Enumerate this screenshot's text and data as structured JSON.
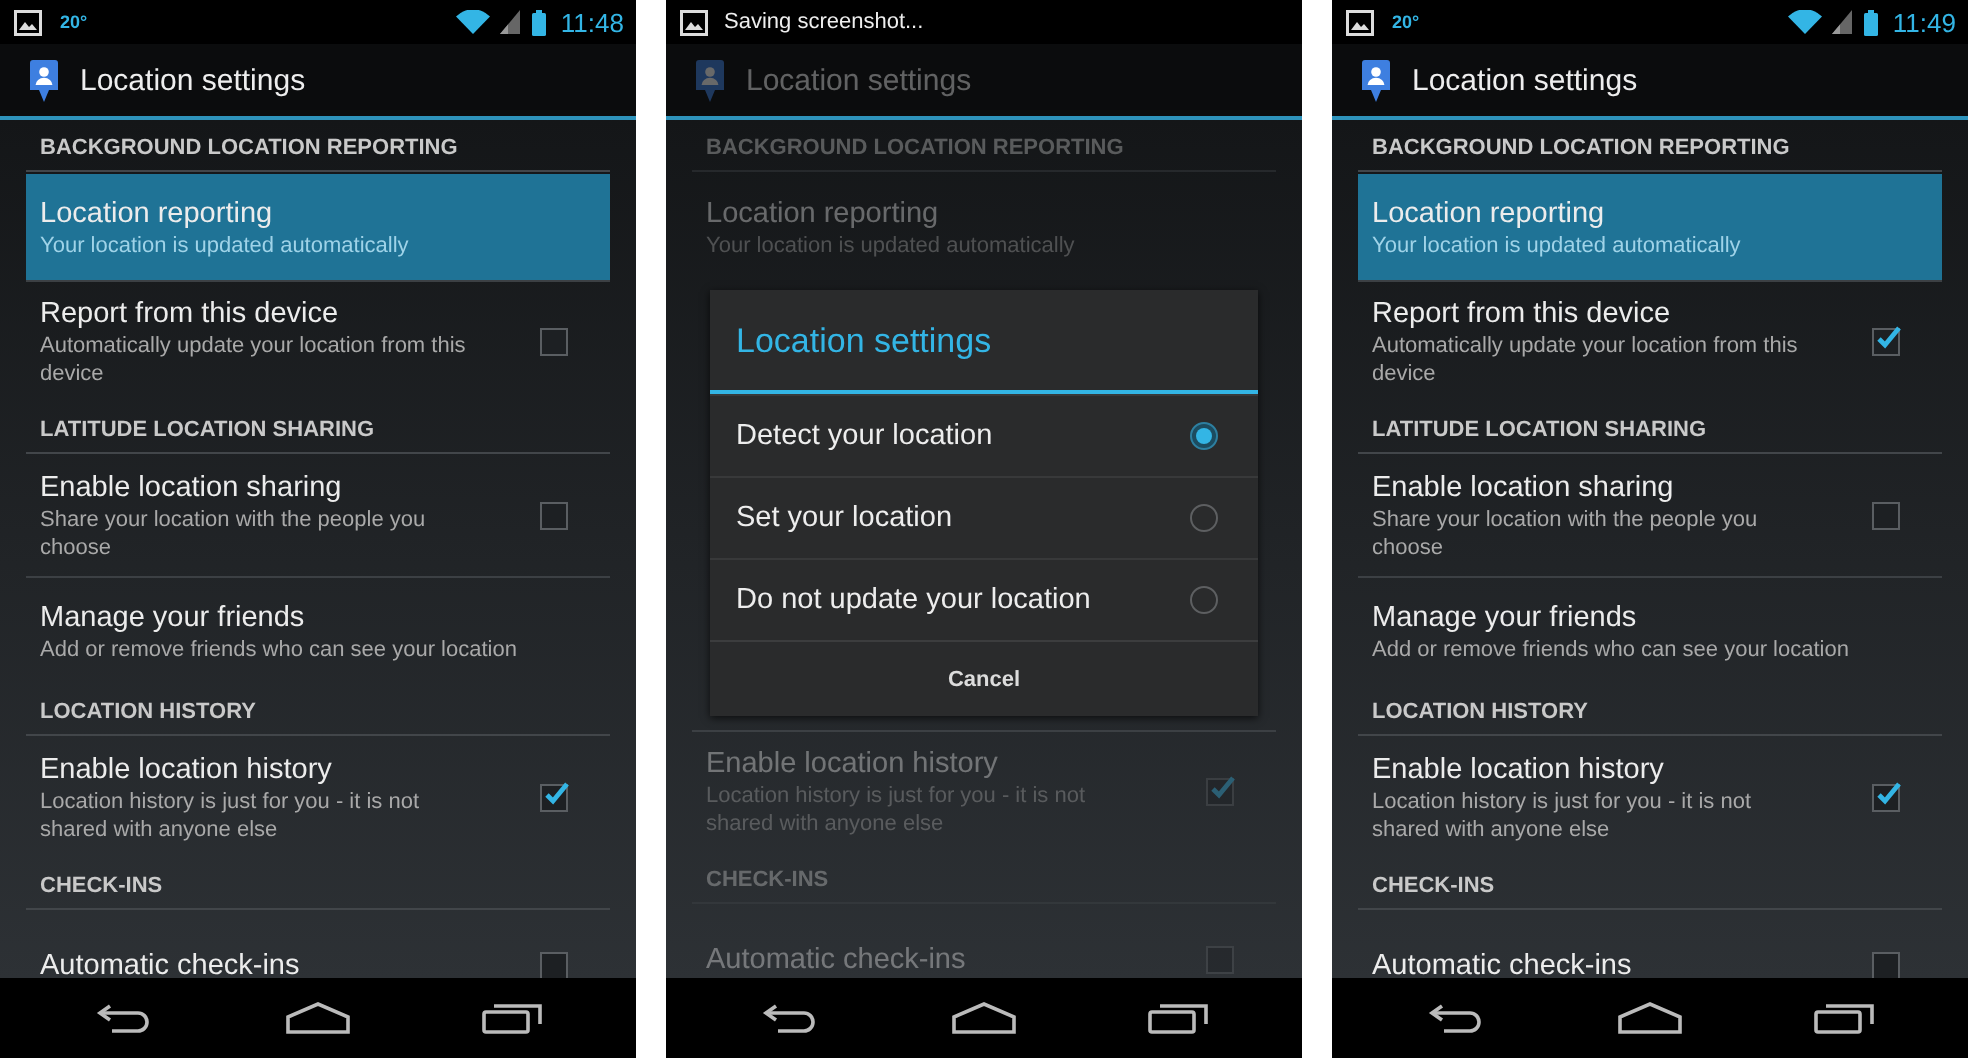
{
  "phones": [
    {
      "status_bar": {
        "notification": {
          "kind": "temperature",
          "text": "20°"
        },
        "time": "11:48"
      },
      "action_bar": {
        "title": "Location settings"
      },
      "dimmed": false,
      "content": [
        {
          "kind": "section",
          "header": "BACKGROUND LOCATION REPORTING",
          "items": [
            {
              "kind": "link",
              "title": "Location reporting",
              "subtitle": "Your location is updated automatically",
              "highlighted": true
            },
            {
              "kind": "checkbox",
              "title": "Report from this device",
              "subtitle": "Automatically update your location from this device",
              "checked": false,
              "highlighted": false
            }
          ]
        },
        {
          "kind": "section",
          "header": "LATITUDE LOCATION SHARING",
          "items": [
            {
              "kind": "checkbox",
              "title": "Enable location sharing",
              "subtitle": "Share your location with the people you choose",
              "checked": false,
              "highlighted": false
            },
            {
              "kind": "link",
              "title": "Manage your friends",
              "subtitle": "Add or remove friends who can see your location",
              "highlighted": false
            }
          ]
        },
        {
          "kind": "section",
          "header": "LOCATION HISTORY",
          "items": [
            {
              "kind": "checkbox",
              "title": "Enable location history",
              "subtitle": "Location history is just for you - it is not shared with anyone else",
              "checked": true,
              "highlighted": false
            }
          ]
        },
        {
          "kind": "section",
          "header": "CHECK-INS",
          "items": [
            {
              "kind": "checkbox",
              "title": "Automatic check-ins",
              "checked": false,
              "highlighted": false
            }
          ]
        }
      ]
    },
    {
      "status_bar": {
        "notification": {
          "kind": "message",
          "text": "Saving screenshot..."
        }
      },
      "action_bar": {
        "title": "Location settings"
      },
      "dimmed": true,
      "content": [
        {
          "kind": "section",
          "header": "BACKGROUND LOCATION REPORTING",
          "items": [
            {
              "kind": "link",
              "title": "Location reporting",
              "subtitle": "Your location is updated automatically",
              "highlighted": false
            }
          ]
        },
        {
          "kind": "dialog",
          "title": "Location settings",
          "options": [
            {
              "label": "Detect your location",
              "selected": true
            },
            {
              "label": "Set your location",
              "selected": false
            },
            {
              "label": "Do not update your location",
              "selected": false
            }
          ],
          "button": "Cancel"
        },
        {
          "kind": "section",
          "items": [
            {
              "kind": "checkbox",
              "title": "Enable location history",
              "subtitle": "Location history is just for you - it is not shared with anyone else",
              "checked": true,
              "highlighted": false
            }
          ]
        },
        {
          "kind": "section",
          "header": "CHECK-INS",
          "items": [
            {
              "kind": "checkbox",
              "title": "Automatic check-ins",
              "checked": false,
              "highlighted": false
            }
          ]
        }
      ]
    },
    {
      "status_bar": {
        "notification": {
          "kind": "temperature",
          "text": "20°"
        },
        "time": "11:49"
      },
      "action_bar": {
        "title": "Location settings"
      },
      "dimmed": false,
      "content": [
        {
          "kind": "section",
          "header": "BACKGROUND LOCATION REPORTING",
          "items": [
            {
              "kind": "link",
              "title": "Location reporting",
              "subtitle": "Your location is updated automatically",
              "highlighted": true
            },
            {
              "kind": "checkbox",
              "title": "Report from this device",
              "subtitle": "Automatically update your location from this device",
              "checked": true,
              "highlighted": false
            }
          ]
        },
        {
          "kind": "section",
          "header": "LATITUDE LOCATION SHARING",
          "items": [
            {
              "kind": "checkbox",
              "title": "Enable location sharing",
              "subtitle": "Share your location with the people you choose",
              "checked": false,
              "highlighted": false
            },
            {
              "kind": "link",
              "title": "Manage your friends",
              "subtitle": "Add or remove friends who can see your location",
              "highlighted": false
            }
          ]
        },
        {
          "kind": "section",
          "header": "LOCATION HISTORY",
          "items": [
            {
              "kind": "checkbox",
              "title": "Enable location history",
              "subtitle": "Location history is just for you - it is not shared with anyone else",
              "checked": true,
              "highlighted": false
            }
          ]
        },
        {
          "kind": "section",
          "header": "CHECK-INS",
          "items": [
            {
              "kind": "checkbox",
              "title": "Automatic check-ins",
              "checked": false,
              "highlighted": false
            }
          ]
        }
      ]
    }
  ]
}
